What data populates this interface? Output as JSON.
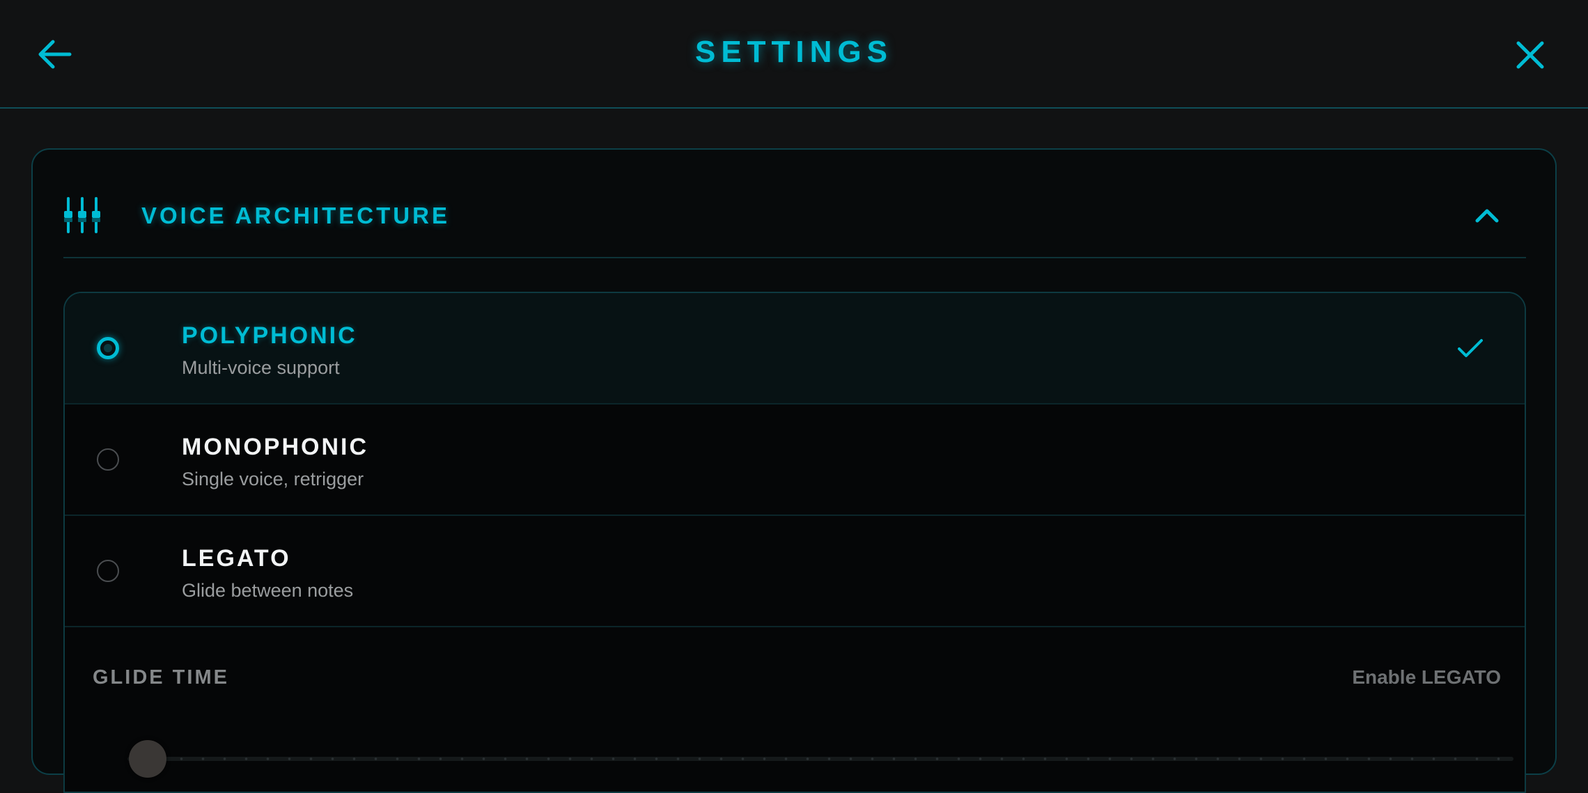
{
  "header": {
    "title": "SETTINGS",
    "back_icon": "arrow-left-icon",
    "close_icon": "close-icon"
  },
  "section": {
    "title": "VOICE ARCHITECTURE",
    "icon": "mixer-sliders-icon",
    "expanded": true
  },
  "options": [
    {
      "name": "POLYPHONIC",
      "desc": "Multi-voice support",
      "selected": true
    },
    {
      "name": "MONOPHONIC",
      "desc": "Single voice, retrigger",
      "selected": false
    },
    {
      "name": "LEGATO",
      "desc": "Glide between notes",
      "selected": false
    }
  ],
  "glide": {
    "label": "GLIDE TIME",
    "hint": "Enable LEGATO",
    "value": 0,
    "enabled": false
  },
  "colors": {
    "accent": "#00bcd4",
    "background": "#111213",
    "panel": "#070a0b"
  }
}
